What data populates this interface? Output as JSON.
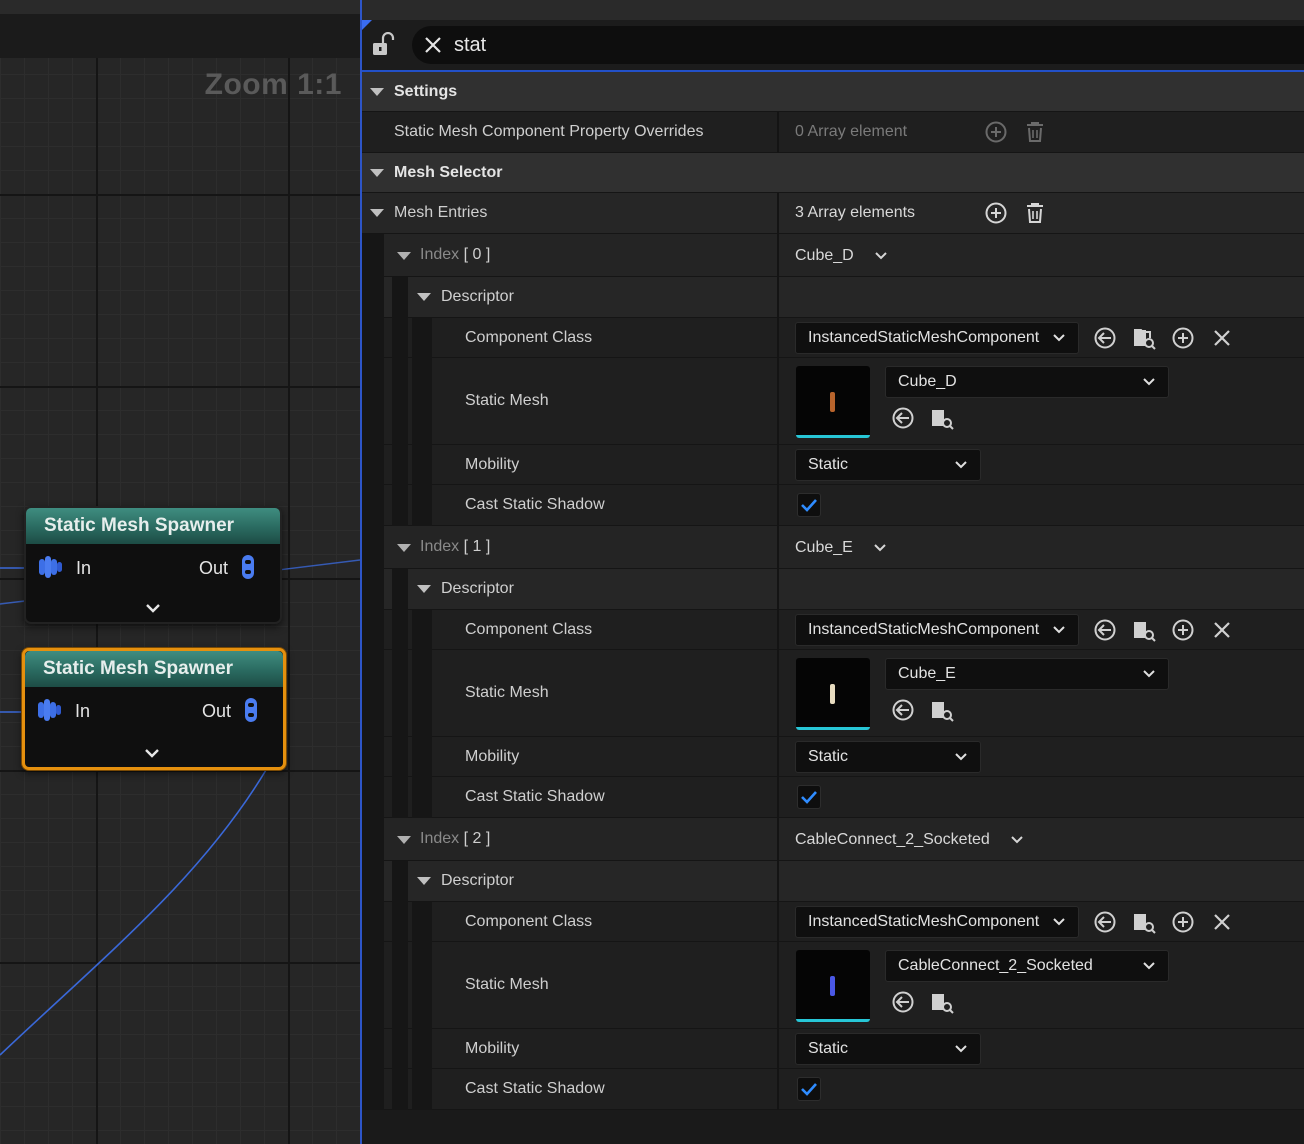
{
  "graph": {
    "zoom_label": "Zoom 1:1",
    "nodes": [
      {
        "title": "Static Mesh Spawner",
        "in_label": "In",
        "out_label": "Out",
        "selected": false
      },
      {
        "title": "Static Mesh Spawner",
        "in_label": "In",
        "out_label": "Out",
        "selected": true
      }
    ]
  },
  "search": {
    "query": "stat"
  },
  "settings": {
    "label": "Settings",
    "overrides_label": "Static Mesh Component Property Overrides",
    "overrides_value": "0 Array element"
  },
  "mesh_selector": {
    "label": "Mesh Selector",
    "entries_label": "Mesh Entries",
    "entries_value": "3 Array elements",
    "entries": [
      {
        "index_label": "Index",
        "index_num": "[ 0 ]",
        "value": "Cube_D",
        "descriptor_label": "Descriptor",
        "component_class_label": "Component Class",
        "component_class": "InstancedStaticMeshComponent",
        "static_mesh_label": "Static Mesh",
        "static_mesh": "Cube_D",
        "mobility_label": "Mobility",
        "mobility": "Static",
        "cast_shadow_label": "Cast Static Shadow",
        "cast_shadow": true,
        "thumb_color": "#b8642c"
      },
      {
        "index_label": "Index",
        "index_num": "[ 1 ]",
        "value": "Cube_E",
        "descriptor_label": "Descriptor",
        "component_class_label": "Component Class",
        "component_class": "InstancedStaticMeshComponent",
        "static_mesh_label": "Static Mesh",
        "static_mesh": "Cube_E",
        "mobility_label": "Mobility",
        "mobility": "Static",
        "cast_shadow_label": "Cast Static Shadow",
        "cast_shadow": true,
        "thumb_color": "#e8dcc0"
      },
      {
        "index_label": "Index",
        "index_num": "[ 2 ]",
        "value": "CableConnect_2_Socketed",
        "descriptor_label": "Descriptor",
        "component_class_label": "Component Class",
        "component_class": "InstancedStaticMeshComponent",
        "static_mesh_label": "Static Mesh",
        "static_mesh": "CableConnect_2_Socketed",
        "mobility_label": "Mobility",
        "mobility": "Static",
        "cast_shadow_label": "Cast Static Shadow",
        "cast_shadow": true,
        "thumb_color": "#4a58e6"
      }
    ]
  },
  "colors": {
    "accent": "#2250c8",
    "selection": "#e5900e",
    "node_header": "#2a6a60",
    "check": "#2f8cff"
  }
}
